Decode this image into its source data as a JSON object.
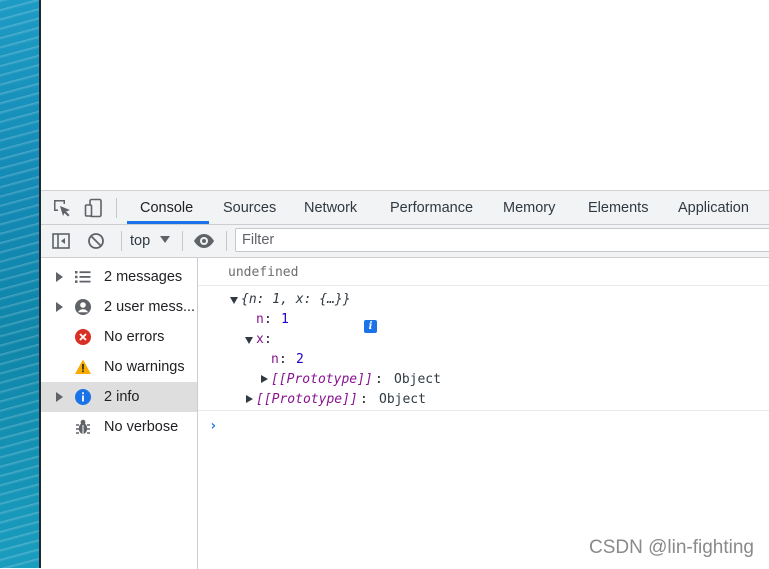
{
  "tabs": [
    {
      "label": "Console",
      "active": true
    },
    {
      "label": "Sources"
    },
    {
      "label": "Network"
    },
    {
      "label": "Performance"
    },
    {
      "label": "Memory"
    },
    {
      "label": "Elements"
    },
    {
      "label": "Application"
    }
  ],
  "toolbar": {
    "context": "top",
    "filter_placeholder": "Filter"
  },
  "sidebar": {
    "items": [
      {
        "label": "2 messages",
        "icon": "list-icon",
        "expandable": true
      },
      {
        "label": "2 user mess...",
        "icon": "user-icon",
        "expandable": true
      },
      {
        "label": "No errors",
        "icon": "error-icon"
      },
      {
        "label": "No warnings",
        "icon": "warning-icon"
      },
      {
        "label": "2 info",
        "icon": "info-icon",
        "expandable": true,
        "selected": true
      },
      {
        "label": "No verbose",
        "icon": "bug-icon"
      }
    ]
  },
  "console": {
    "undefined_text": "undefined",
    "object_preview": "{n: 1, x: {…}}",
    "prop_n": "n",
    "prop_n_value": "1",
    "prop_x": "x",
    "nested_n": "n",
    "nested_n_value": "2",
    "prototype_key": "[[Prototype]]",
    "prototype_value": "Object",
    "colon": ":",
    "info_badge": "i"
  },
  "colors": {
    "accent": "#1a73e8",
    "property_key": "#881391",
    "number": "#1c00cf",
    "error": "#d93025",
    "warning": "#f9ab00"
  },
  "watermark": "CSDN @lin-fighting"
}
